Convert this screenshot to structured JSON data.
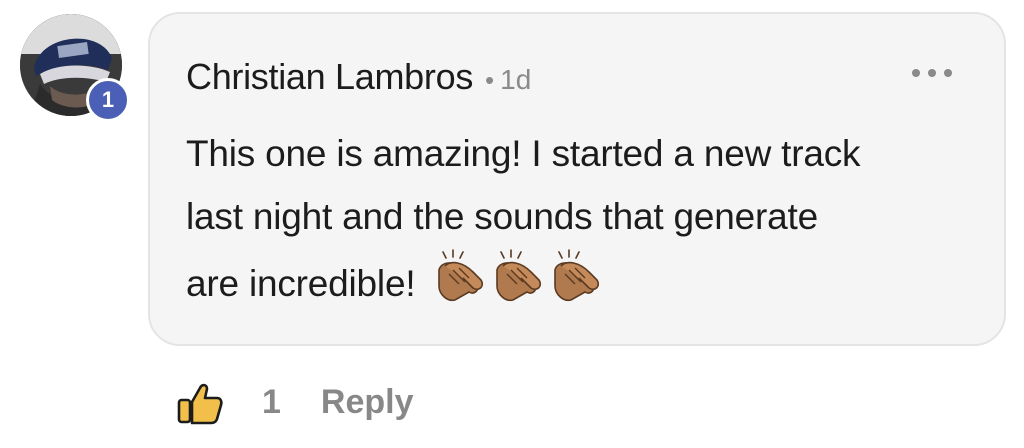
{
  "comment": {
    "author": "Christian Lambros",
    "separator": "•",
    "time": "1d",
    "avatar_badge": "1",
    "text_lines": [
      "This one is amazing! I started a new track",
      "last night and the sounds that generate",
      "are incredible!"
    ],
    "emoji": [
      "clapping-hands",
      "clapping-hands",
      "clapping-hands"
    ],
    "more_icon": "more-horizontal-icon"
  },
  "footer": {
    "like_icon": "thumbs-up-icon",
    "like_count": "1",
    "reply_label": "Reply"
  },
  "colors": {
    "bubble_bg": "#f5f5f5",
    "bubble_border": "#e4e4e4",
    "badge": "#4a5fb5",
    "like_icon_fill": "#f2c04a",
    "muted_text": "#888888"
  }
}
